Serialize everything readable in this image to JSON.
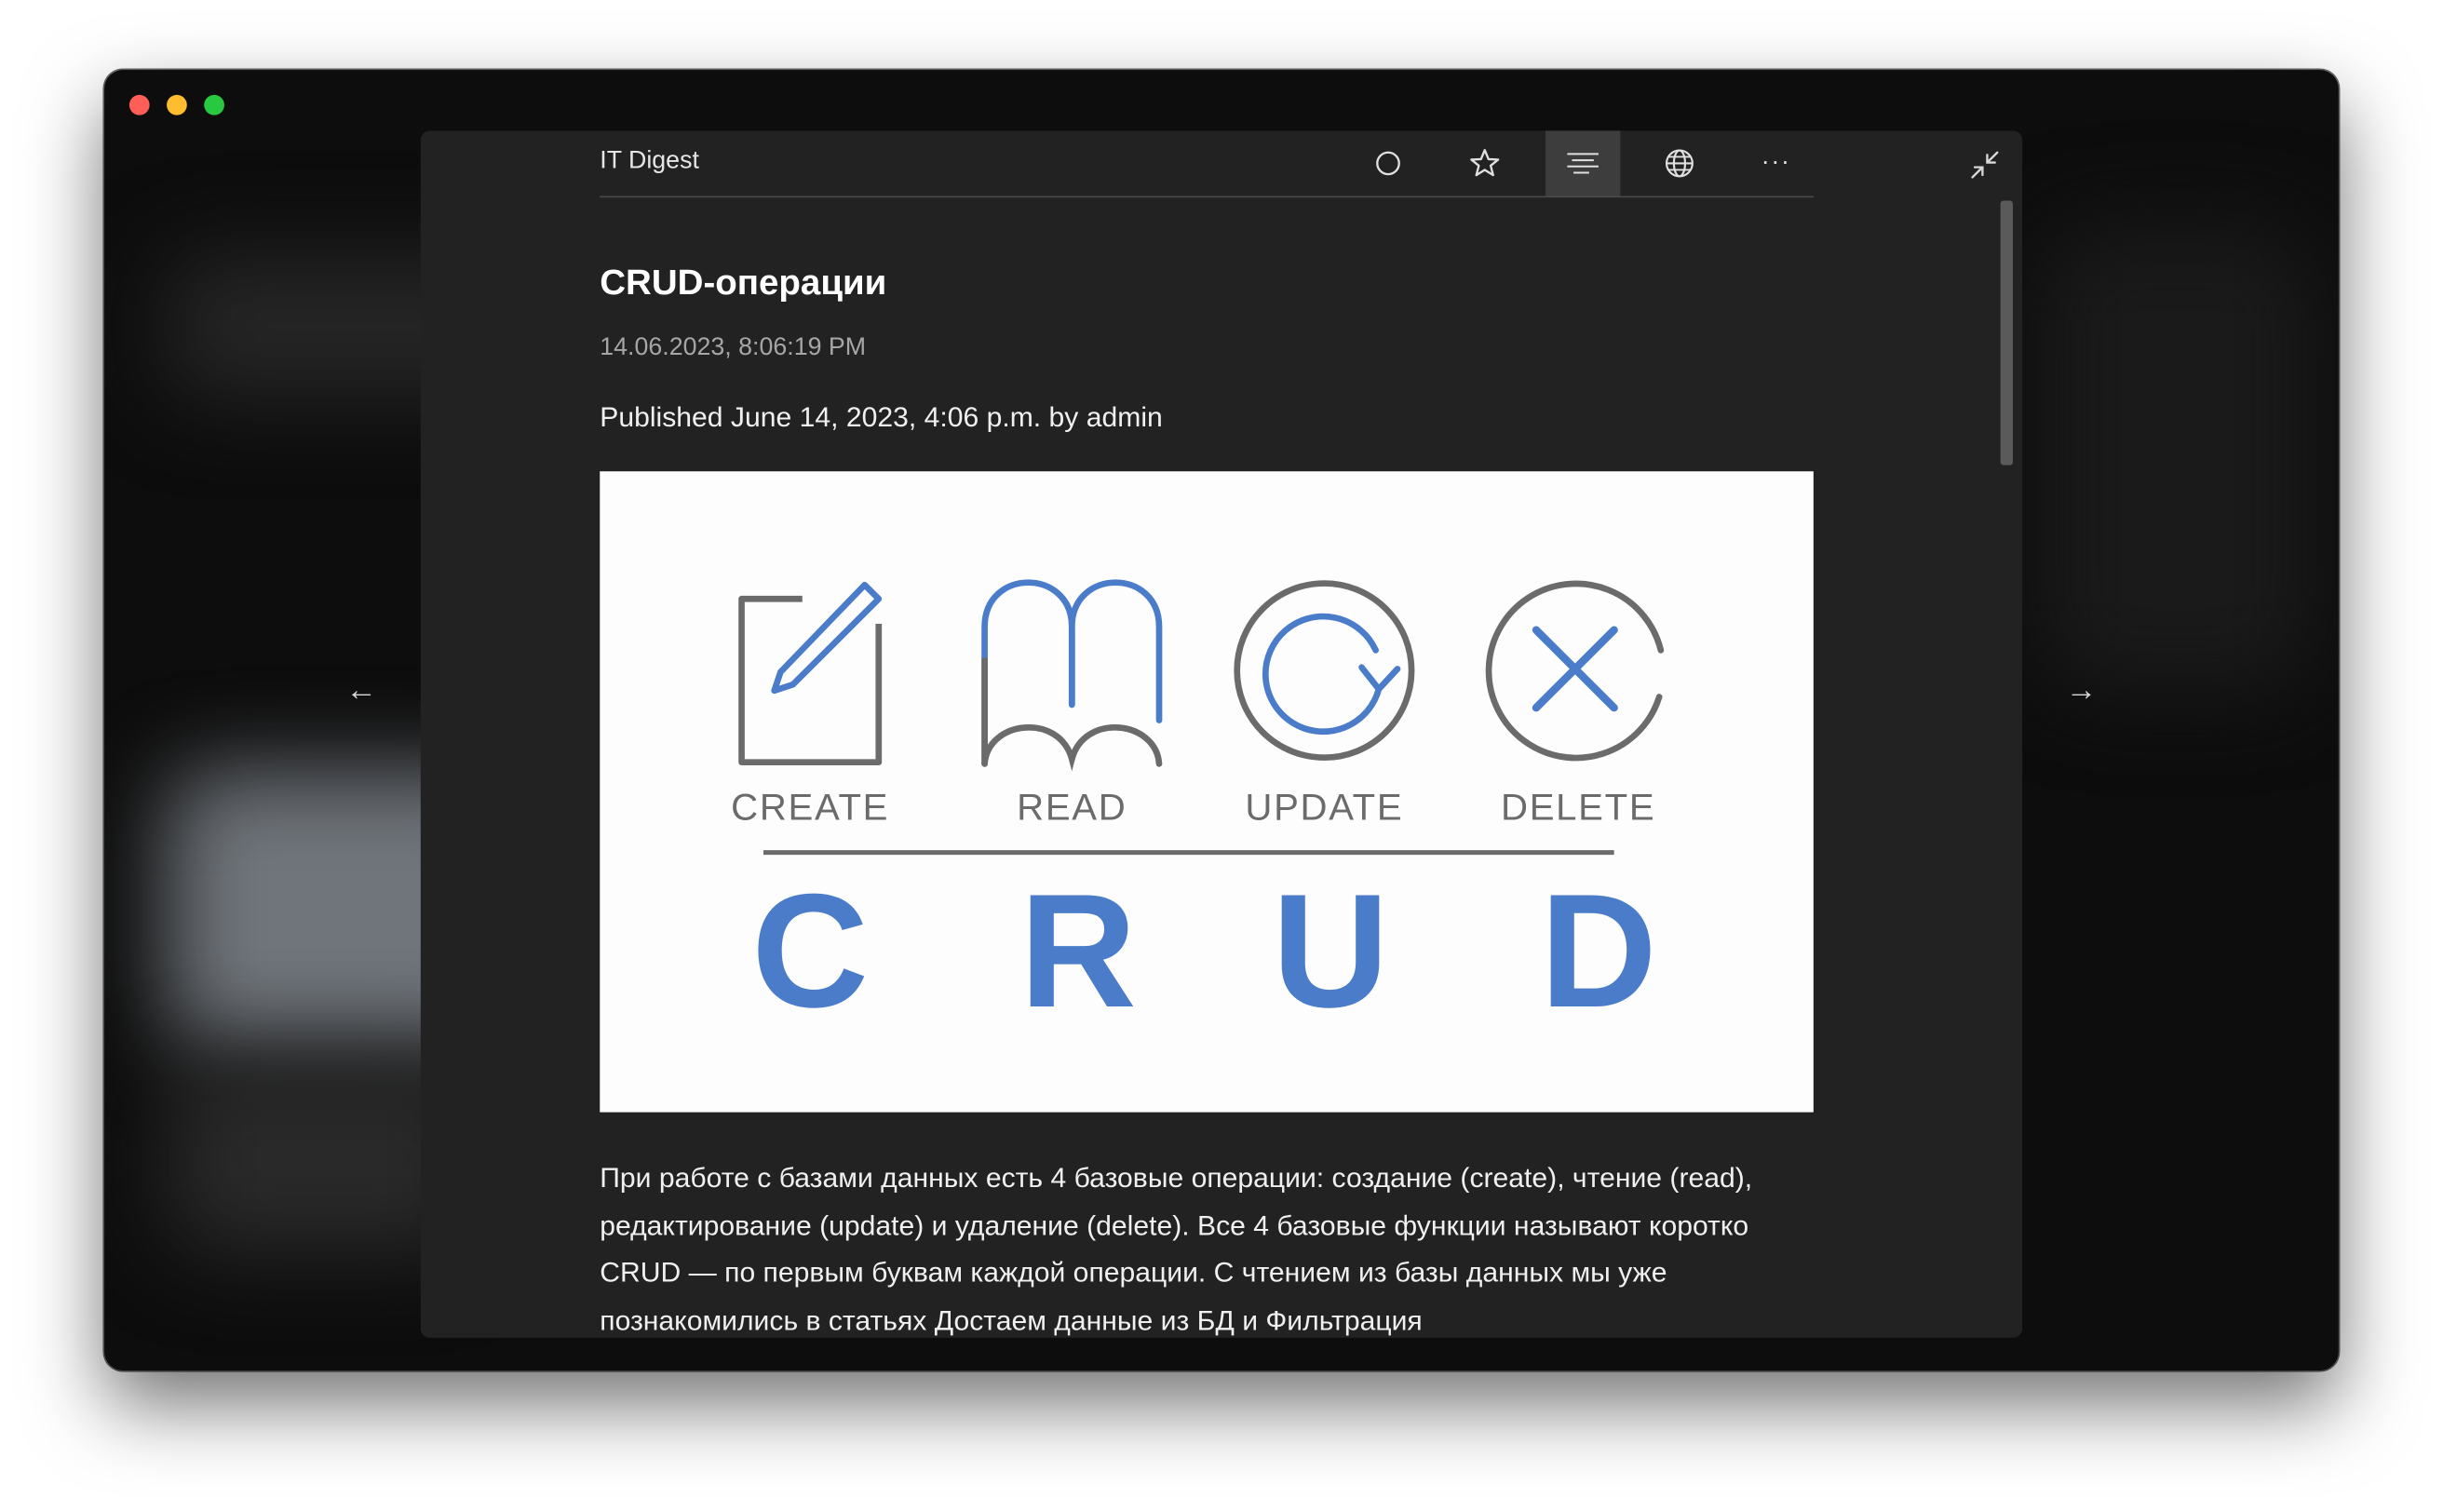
{
  "reader": {
    "site_title": "IT Digest",
    "toolbar": {
      "icons": [
        "circle-icon",
        "star-icon",
        "reader-view-icon",
        "globe-icon",
        "more-icon"
      ],
      "more_label": "···"
    }
  },
  "article": {
    "title": "CRUD-операции",
    "date": "14.06.2023, 8:06:19 PM",
    "byline": "Published June 14, 2023, 4:06 p.m. by admin",
    "image": {
      "operations": [
        "CREATE",
        "READ",
        "UPDATE",
        "DELETE"
      ],
      "letters": [
        "C",
        "R",
        "U",
        "D"
      ],
      "accent_color": "#4a7cc9",
      "gray_color": "#6b6b6b"
    },
    "body": "При работе с базами данных есть 4 базовые операции: создание (create), чтение (read), редактирование (update) и удаление (delete). Все 4 базовые функции называют коротко CRUD — по первым буквам каждой операции. С чтением из базы данных мы уже познакомились в статьях Достаем данные из БД и Фильтрация"
  },
  "navigation": {
    "prev_arrow": "←",
    "next_arrow": "→"
  },
  "colors": {
    "window_bg": "#0d0d0d",
    "reader_bg": "#222222",
    "traffic_close": "#ff5f57",
    "traffic_min": "#febc2e",
    "traffic_max": "#28c840"
  }
}
